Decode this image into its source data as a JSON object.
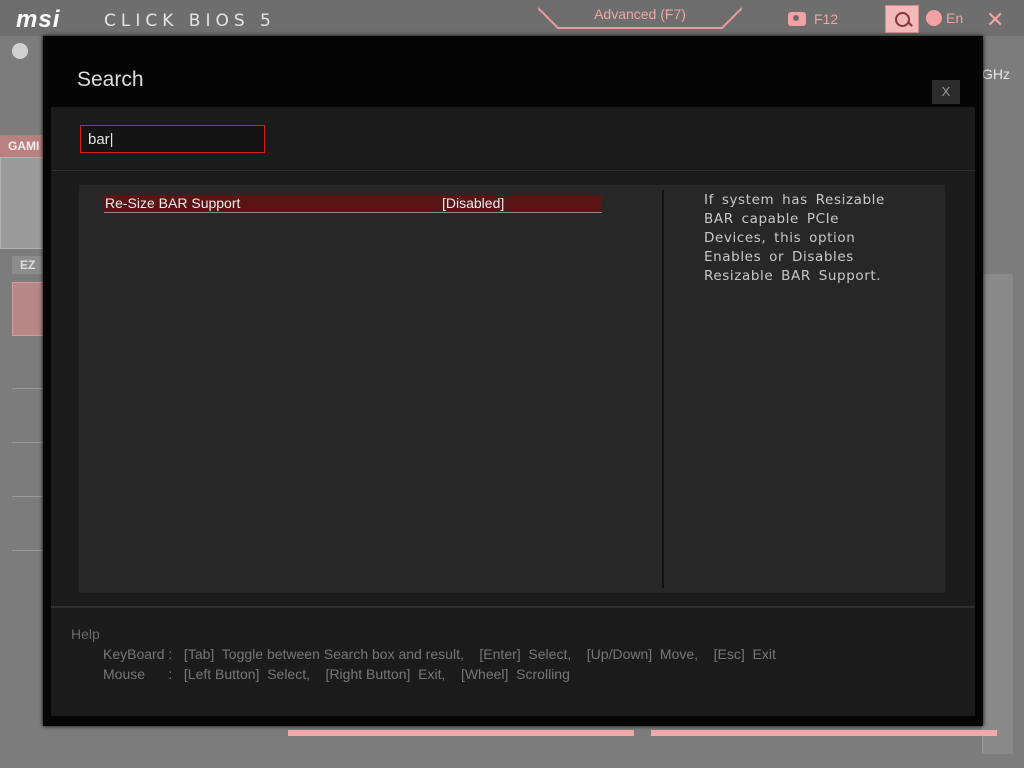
{
  "app": {
    "brand": "msi",
    "product": "CLICK BIOS 5",
    "mode_tab": "Advanced (F7)",
    "screenshot_key": "F12",
    "language": "En",
    "cpu_freq_partial": "GHz",
    "sidebar_partial_label": "GAMI",
    "ez_label": "EZ"
  },
  "modal": {
    "title": "Search",
    "close_label": "X",
    "search_value": "bar|",
    "results": [
      {
        "name": "Re-Size BAR Support",
        "value": "[Disabled]",
        "selected": true
      }
    ],
    "description": "If system has Resizable BAR capable PCIe Devices, this option Enables or Disables Resizable BAR Support.",
    "help": {
      "title": "Help",
      "keyboard": "KeyBoard :   [Tab]  Toggle between Search box and result,    [Enter]  Select,    [Up/Down]  Move,    [Esc]  Exit",
      "mouse": "Mouse      :   [Left Button]  Select,    [Right Button]  Exit,    [Wheel]  Scrolling"
    }
  },
  "colors": {
    "accent": "#cc2020",
    "selected_row": "#5a1414",
    "modal_bg": "#050505",
    "panel_bg": "#272727"
  },
  "icons": [
    "clock-icon",
    "camera-icon",
    "search-icon",
    "globe-icon",
    "close-icon"
  ]
}
